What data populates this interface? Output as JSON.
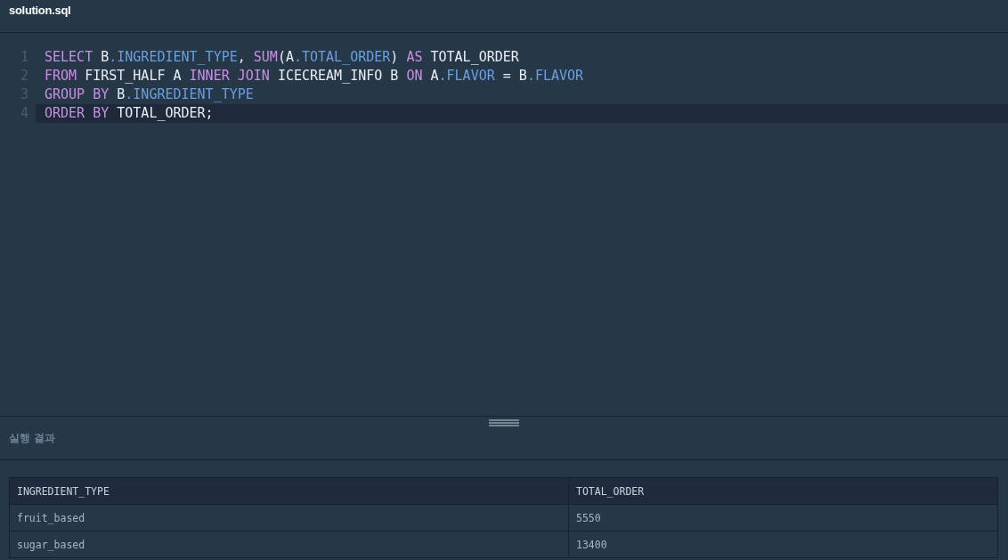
{
  "tab": {
    "title": "solution.sql"
  },
  "editor": {
    "lines": [
      {
        "number": "1",
        "active": false,
        "tokens": [
          {
            "kind": "keyword",
            "text": "SELECT"
          },
          {
            "kind": "plain",
            "text": " B"
          },
          {
            "kind": "field",
            "text": ".INGREDIENT_TYPE"
          },
          {
            "kind": "plain",
            "text": ", "
          },
          {
            "kind": "keyword",
            "text": "SUM"
          },
          {
            "kind": "plain",
            "text": "(A"
          },
          {
            "kind": "field",
            "text": ".TOTAL_ORDER"
          },
          {
            "kind": "plain",
            "text": ") "
          },
          {
            "kind": "keyword",
            "text": "AS"
          },
          {
            "kind": "plain",
            "text": " TOTAL_ORDER"
          }
        ]
      },
      {
        "number": "2",
        "active": false,
        "tokens": [
          {
            "kind": "keyword",
            "text": "FROM"
          },
          {
            "kind": "plain",
            "text": " FIRST_HALF A "
          },
          {
            "kind": "keyword",
            "text": "INNER JOIN"
          },
          {
            "kind": "plain",
            "text": " ICECREAM_INFO B "
          },
          {
            "kind": "keyword",
            "text": "ON"
          },
          {
            "kind": "plain",
            "text": " A"
          },
          {
            "kind": "field",
            "text": ".FLAVOR"
          },
          {
            "kind": "plain",
            "text": " = B"
          },
          {
            "kind": "field",
            "text": ".FLAVOR"
          }
        ]
      },
      {
        "number": "3",
        "active": false,
        "tokens": [
          {
            "kind": "keyword",
            "text": "GROUP BY"
          },
          {
            "kind": "plain",
            "text": " B"
          },
          {
            "kind": "field",
            "text": ".INGREDIENT_TYPE"
          }
        ]
      },
      {
        "number": "4",
        "active": true,
        "tokens": [
          {
            "kind": "keyword",
            "text": "ORDER BY"
          },
          {
            "kind": "plain",
            "text": " TOTAL_ORDER;"
          }
        ]
      }
    ]
  },
  "results": {
    "title": "실행 결과",
    "table": {
      "columns": [
        "INGREDIENT_TYPE",
        "TOTAL_ORDER"
      ],
      "rows": [
        [
          "fruit_based",
          "5550"
        ],
        [
          "sugar_based",
          "13400"
        ]
      ]
    }
  }
}
